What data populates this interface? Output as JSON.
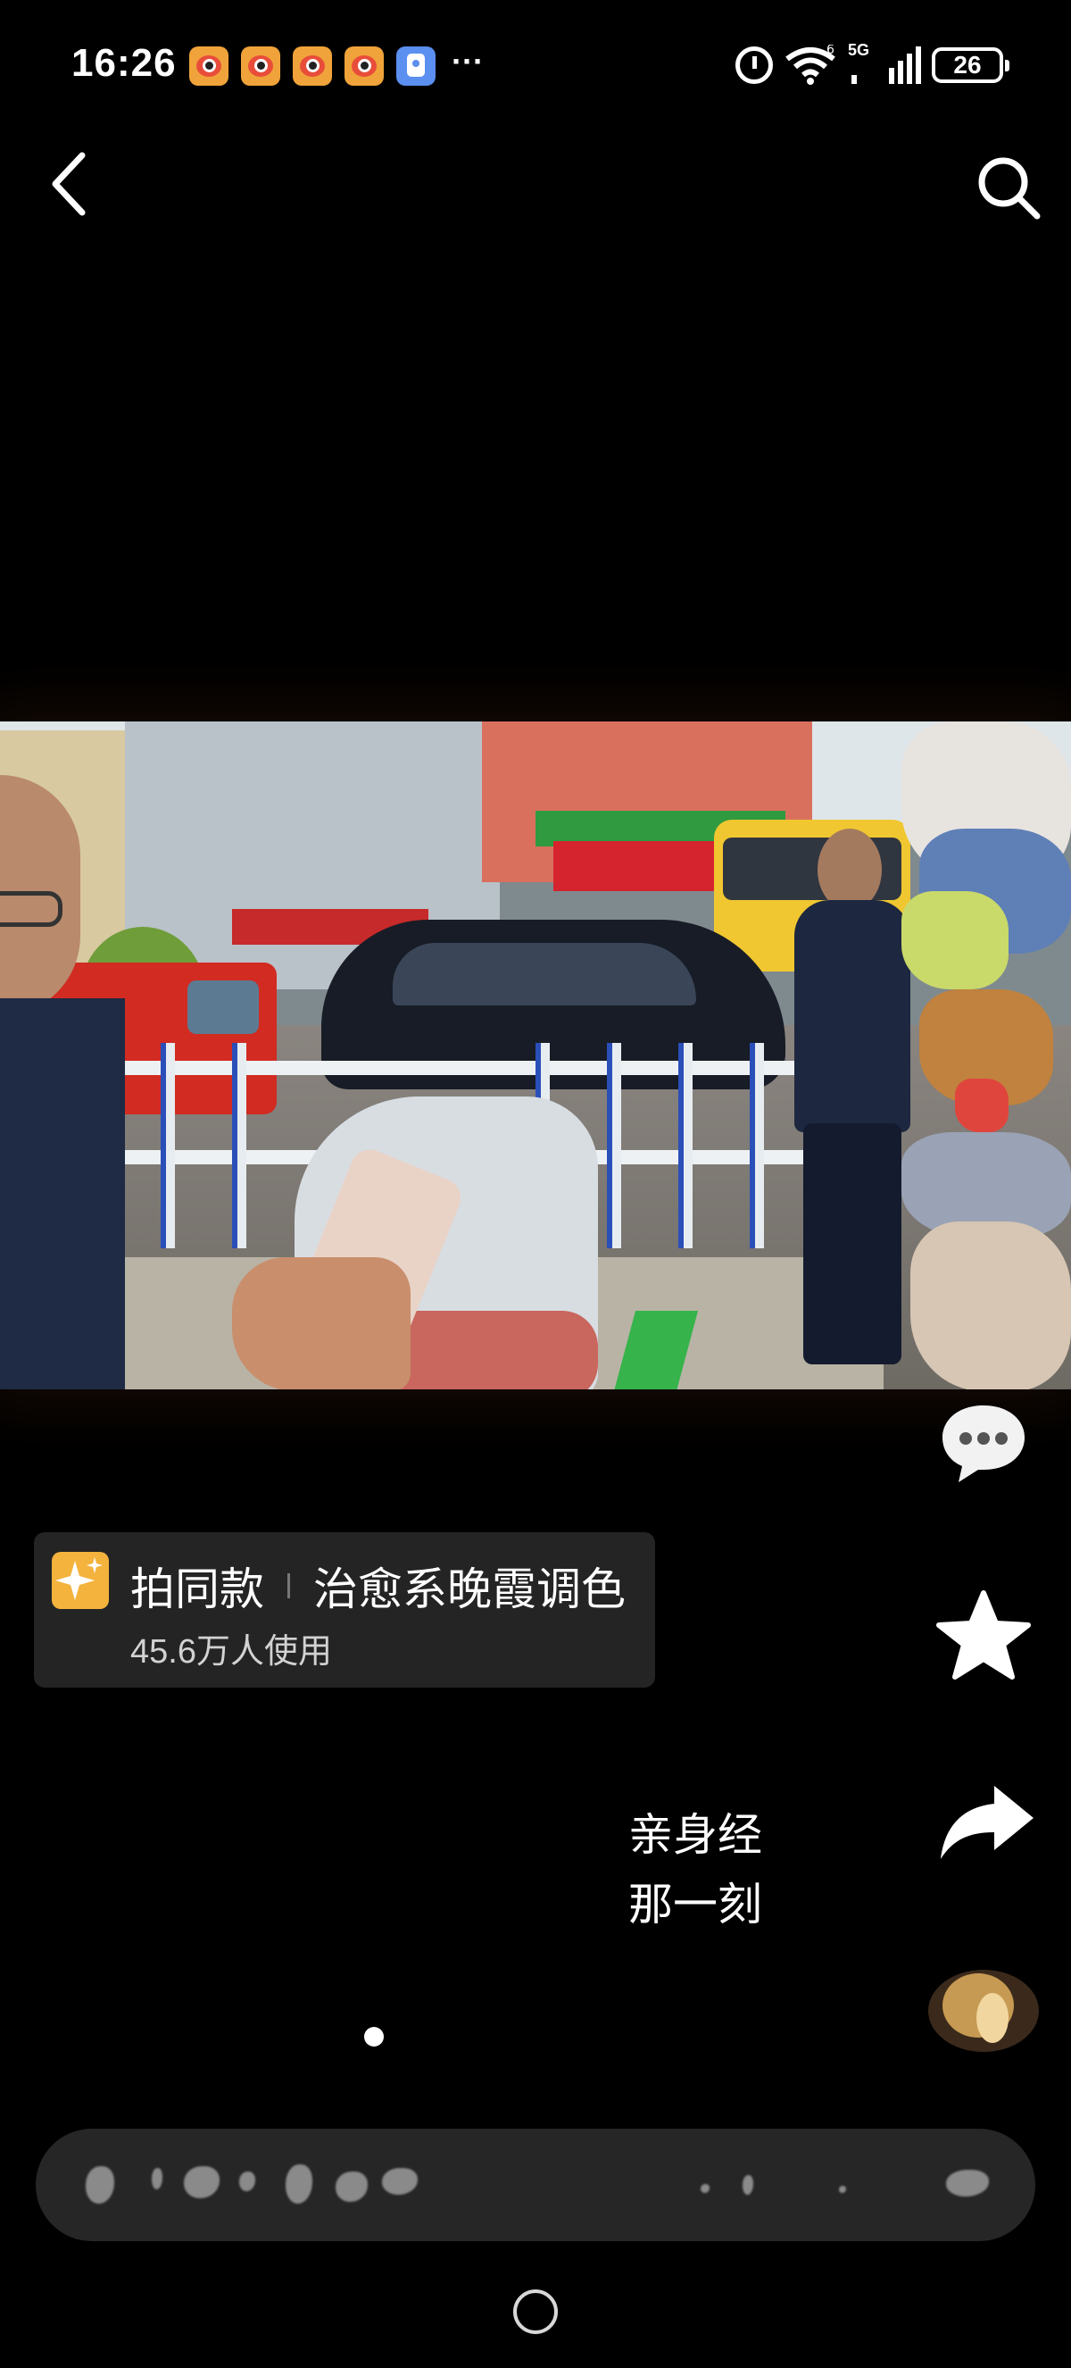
{
  "status_bar": {
    "time": "16:26",
    "notification_icons": [
      "weibo-icon",
      "weibo-icon",
      "weibo-icon",
      "weibo-icon",
      "assistant-app-icon"
    ],
    "more": "···",
    "network_label": "5G",
    "wifi_label": "6",
    "battery": "26"
  },
  "nav": {
    "back_icon": "chevron-left-icon",
    "search_icon": "search-icon"
  },
  "template": {
    "action": "拍同款",
    "name": "治愈系晚霞调色",
    "usage": "45.6万人使用",
    "icon": "sparkle-icon"
  },
  "caption": {
    "line1": "亲身经",
    "line2": "那一刻"
  },
  "side_actions": [
    "comment-icon",
    "star-icon",
    "share-icon",
    "author-avatar"
  ],
  "colors": {
    "background": "#000000",
    "pill_bg": "#242424",
    "sparkle": "#f3b33d",
    "comment_bar": "#262626"
  }
}
